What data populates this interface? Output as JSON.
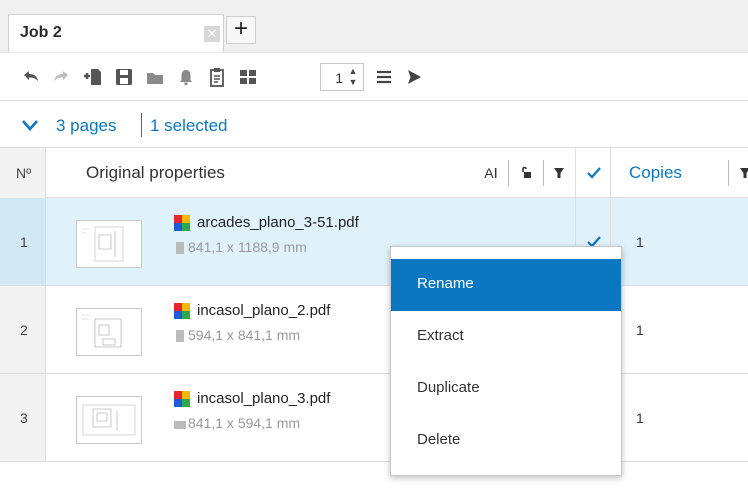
{
  "tabs": {
    "active_label": "Job 2",
    "close_symbol": "✕",
    "add_symbol": "+"
  },
  "toolbar": {
    "icons": [
      "undo-icon",
      "redo-icon",
      "add-file-icon",
      "save-icon",
      "folder-icon",
      "bell-icon",
      "clipboard-icon",
      "grid-icon",
      "menu-icon",
      "send-icon"
    ],
    "stepper_value": "1"
  },
  "selection": {
    "pages_label": "3 pages",
    "selected_label": "1 selected"
  },
  "table": {
    "headers": {
      "number": "Nº",
      "original_properties": "Original properties",
      "copies": "Copies"
    },
    "rows": [
      {
        "number": "1",
        "filename": "arcades_plano_3-51.pdf",
        "size": "841,1 x 1188,9 mm",
        "copies": "1",
        "checked": true,
        "selected": true
      },
      {
        "number": "2",
        "filename": "incasol_plano_2.pdf",
        "size": "594,1 x 841,1 mm",
        "copies": "1",
        "checked": false,
        "selected": false
      },
      {
        "number": "3",
        "filename": "incasol_plano_3.pdf",
        "size": "841,1 x 594,1 mm",
        "copies": "1",
        "checked": false,
        "selected": false
      }
    ]
  },
  "context_menu": {
    "items": [
      "Rename",
      "Extract",
      "Duplicate",
      "Delete"
    ],
    "active_index": 0
  },
  "colors": {
    "accent": "#0b77c1",
    "selected_row": "#dff1fb",
    "row_number_bg": "#f2f2f2"
  }
}
